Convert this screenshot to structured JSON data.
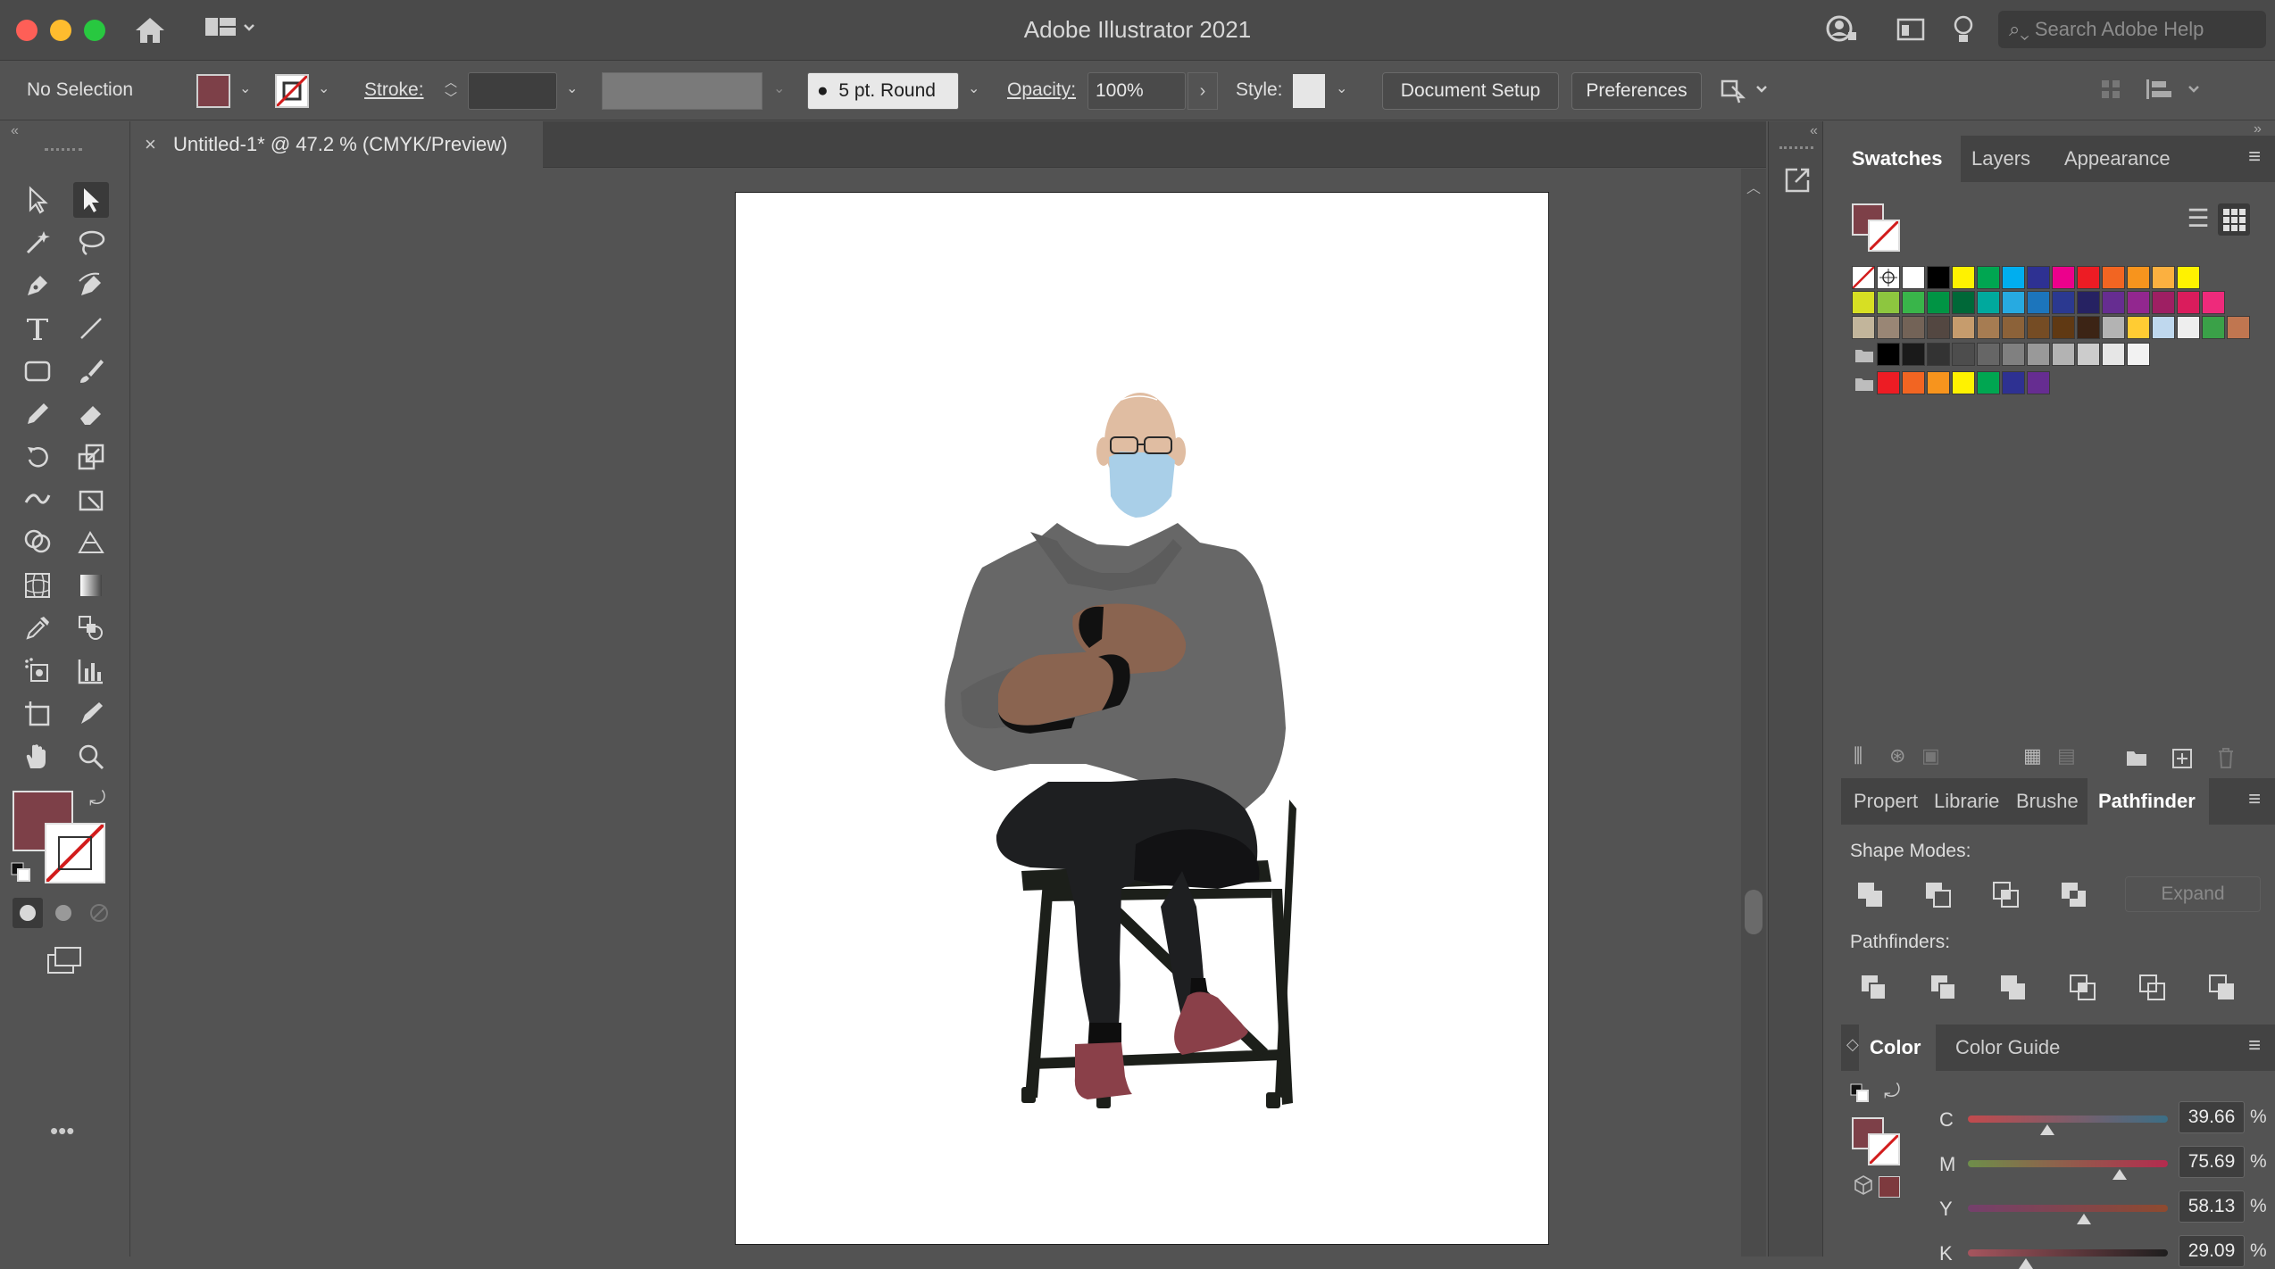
{
  "app": {
    "title": "Adobe Illustrator 2021",
    "search_placeholder": "Search Adobe Help"
  },
  "control_bar": {
    "selection": "No Selection",
    "stroke_label": "Stroke:",
    "brush": "5 pt. Round",
    "opacity_label": "Opacity:",
    "opacity_value": "100%",
    "style_label": "Style:",
    "document_setup": "Document Setup",
    "preferences": "Preferences"
  },
  "document": {
    "tab_title": "Untitled-1* @ 47.2 % (CMYK/Preview)"
  },
  "colors": {
    "fill": "#7d4048",
    "accent": "#a32c2c"
  },
  "swatches_panel": {
    "tabs": [
      "Swatches",
      "Layers",
      "Appearance"
    ],
    "active": "Swatches",
    "rows": [
      [
        "#ffffff",
        "#000000",
        "#fff200",
        "#00a651",
        "#00aeef",
        "#2e3192",
        "#ec008c",
        "#ed1c24",
        "#f26522",
        "#f7941d",
        "#fbb040",
        "#fff200"
      ],
      [
        "#d7df23",
        "#8dc63f",
        "#39b54a",
        "#009444",
        "#006838",
        "#00a99d",
        "#27aae1",
        "#1c75bc",
        "#2b3990",
        "#262262",
        "#662d91",
        "#92278f",
        "#9e1f63",
        "#da1c5c",
        "#ee2a7b"
      ],
      [
        "#c2b59b",
        "#998675",
        "#736357",
        "#534741",
        "#c69c6d",
        "#a67c52",
        "#8c6239",
        "#754c24",
        "#603913",
        "#3c2415",
        "#b3b3b3",
        "#ffcc33",
        "#bfd8ee",
        "#eeeeee",
        "#3aa148",
        "#c07650"
      ],
      [
        "#000000",
        "#1a1a1a",
        "#333333",
        "#4d4d4d",
        "#666666",
        "#808080",
        "#999999",
        "#b3b3b3",
        "#cccccc",
        "#e6e6e6",
        "#f2f2f2"
      ],
      [
        "#ed1c24",
        "#f26522",
        "#f7941d",
        "#fff200",
        "#00a651",
        "#2e3192",
        "#662d91"
      ]
    ]
  },
  "bottom_panel": {
    "tabs": [
      "Propert",
      "Librarie",
      "Brushe",
      "Pathfinder"
    ],
    "active": "Pathfinder",
    "shape_modes_label": "Shape Modes:",
    "expand": "Expand",
    "pathfinders_label": "Pathfinders:"
  },
  "color_panel": {
    "tabs": [
      "Color",
      "Color Guide"
    ],
    "active": "Color",
    "channels": [
      {
        "label": "C",
        "value": "39.66",
        "level": 0.3966
      },
      {
        "label": "M",
        "value": "75.69",
        "level": 0.7569
      },
      {
        "label": "Y",
        "value": "58.13",
        "level": 0.5813
      },
      {
        "label": "K",
        "value": "29.09",
        "level": 0.2909
      }
    ],
    "percent": "%"
  }
}
